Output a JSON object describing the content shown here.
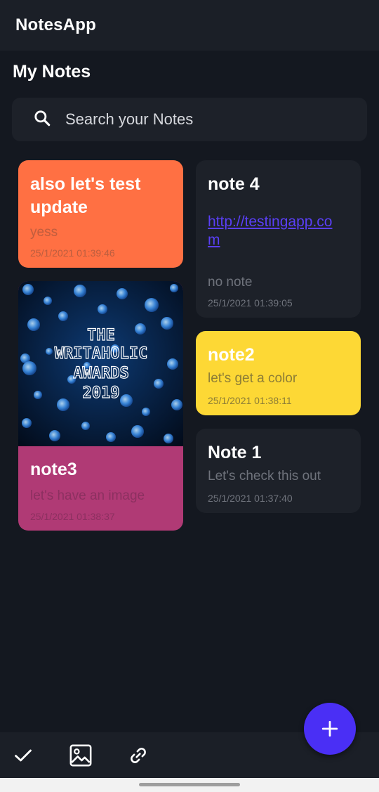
{
  "app": {
    "title": "NotesApp"
  },
  "page": {
    "title": "My Notes"
  },
  "search": {
    "placeholder": "Search your Notes",
    "icon": "search-icon"
  },
  "notes": [
    {
      "title": "also let's test update",
      "subtitle": "yess",
      "datetime": "25/1/2021 01:39:46",
      "color": "#ff7043"
    },
    {
      "title": "note3",
      "subtitle": "let's have an image",
      "datetime": "25/1/2021 01:38:37",
      "color": "#b03a75",
      "image_text": [
        "THE",
        "WRITAHOLIC",
        "AWARDS",
        "2019"
      ]
    },
    {
      "title": "note 4",
      "link": "http://testingapp.com",
      "subtitle": "no note",
      "datetime": "25/1/2021 01:39:05",
      "color": "#1d2129"
    },
    {
      "title": "note2",
      "subtitle": "let's get a color",
      "datetime": "25/1/2021 01:38:11",
      "color": "#fdd835"
    },
    {
      "title": "Note 1",
      "subtitle": "Let's check this out",
      "datetime": "25/1/2021 01:37:40",
      "color": "#1d2129"
    }
  ],
  "toolbar": {
    "icons": [
      "check-icon",
      "image-icon",
      "link-icon"
    ]
  },
  "fab": {
    "icon": "plus-icon",
    "color": "#4a2ff5"
  }
}
